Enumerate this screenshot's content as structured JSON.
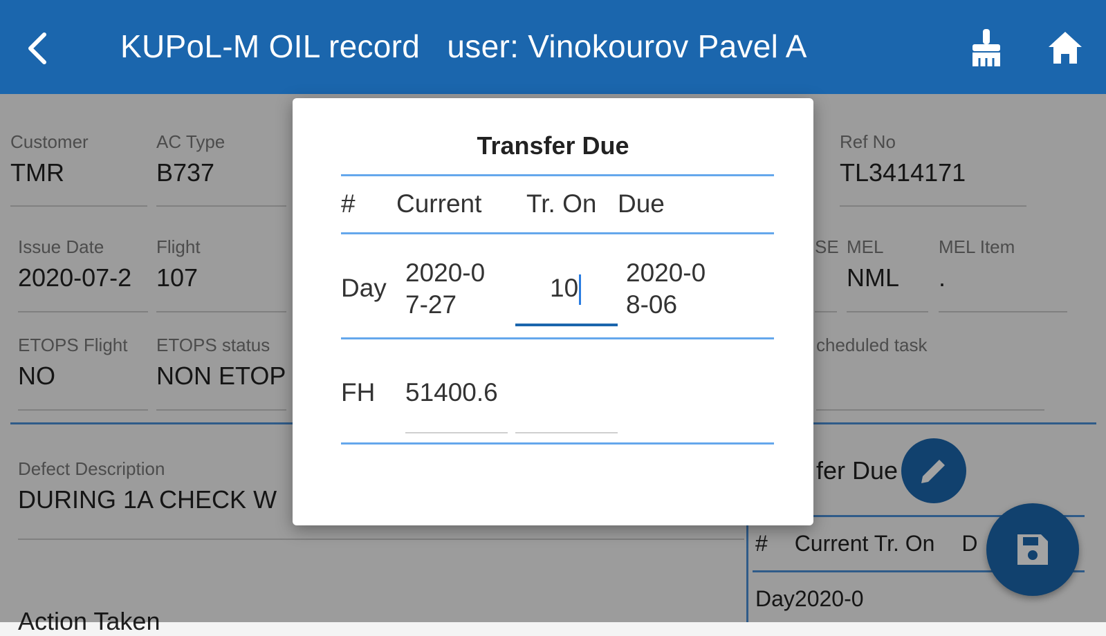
{
  "appbar": {
    "title": "KUPoL-M OIL record   user: Vinokourov Pavel A",
    "back_icon": "arrow-back-icon",
    "clear_icon": "broom-icon",
    "home_icon": "home-icon",
    "color": "#1b66ad"
  },
  "form": {
    "customer": {
      "label": "Customer",
      "value": "TMR"
    },
    "ac_type": {
      "label": "AC Type",
      "value": "B737"
    },
    "ref_no": {
      "label": "Ref No",
      "value": "TL3414171"
    },
    "issue_date": {
      "label": "Issue Date",
      "value": "2020-07-2"
    },
    "flight": {
      "label": "Flight",
      "value": "107"
    },
    "ase": {
      "label": "SE",
      "value": ""
    },
    "mel": {
      "label": "MEL",
      "value": "NML"
    },
    "mel_item": {
      "label": "MEL Item",
      "value": "."
    },
    "etops_flight": {
      "label": "ETOPS Flight",
      "value": "NO"
    },
    "etops_status": {
      "label": "ETOPS status",
      "value": "NON ETOP"
    },
    "scheduled_task": {
      "label": "cheduled task",
      "value": ""
    },
    "defect_description": {
      "label": "Defect Description",
      "value": "DURING 1A CHECK W"
    },
    "transfer_due_label": "fer Due",
    "mini_table": {
      "hash": "#",
      "current_tr_on": "Current Tr. On",
      "due": "D",
      "row_label": "Day",
      "row_value": "2020-0"
    },
    "action_taken_label": "Action Taken"
  },
  "dialog": {
    "title": "Transfer Due",
    "headers": {
      "hash": "#",
      "current": "Current",
      "tr_on": "Tr. On",
      "due": "Due"
    },
    "day_row": {
      "label": "Day",
      "current_line1": "2020-0",
      "current_line2": "7-27",
      "tr_on": "10",
      "due_line1": "2020-0",
      "due_line2": "8-06"
    },
    "fh_row": {
      "label": "FH",
      "current": "51400.6",
      "tr_on": ""
    }
  }
}
